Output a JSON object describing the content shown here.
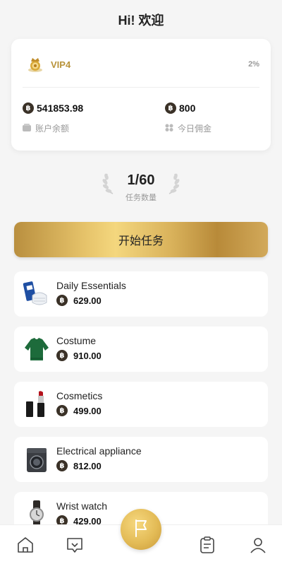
{
  "header": {
    "title": "Hi! 欢迎"
  },
  "vip": {
    "level": "VIP4",
    "rate": "2%",
    "balance": {
      "currency_symbol": "฿",
      "amount": "541853.98",
      "label": "账户余额"
    },
    "commission": {
      "currency_symbol": "฿",
      "amount": "800",
      "label": "今日佣金"
    }
  },
  "tasks": {
    "count": "1/60",
    "label": "任务数量"
  },
  "start_button": {
    "label": "开始任务"
  },
  "items": [
    {
      "name": "Daily Essentials",
      "currency_symbol": "฿",
      "price": "629.00",
      "icon": "daily-essentials-icon"
    },
    {
      "name": "Costume",
      "currency_symbol": "฿",
      "price": "910.00",
      "icon": "sweater-icon"
    },
    {
      "name": "Cosmetics",
      "currency_symbol": "฿",
      "price": "499.00",
      "icon": "lipstick-icon"
    },
    {
      "name": "Electrical appliance",
      "currency_symbol": "฿",
      "price": "812.00",
      "icon": "washing-machine-icon"
    },
    {
      "name": "Wrist watch",
      "currency_symbol": "฿",
      "price": "429.00",
      "icon": "watch-icon"
    }
  ],
  "nav": [
    "home-icon",
    "message-icon",
    "flag-icon",
    "clipboard-icon",
    "profile-icon"
  ],
  "colors": {
    "gold": "#b8933a",
    "coin": "#3a3127",
    "background": "#f5f5f5"
  }
}
